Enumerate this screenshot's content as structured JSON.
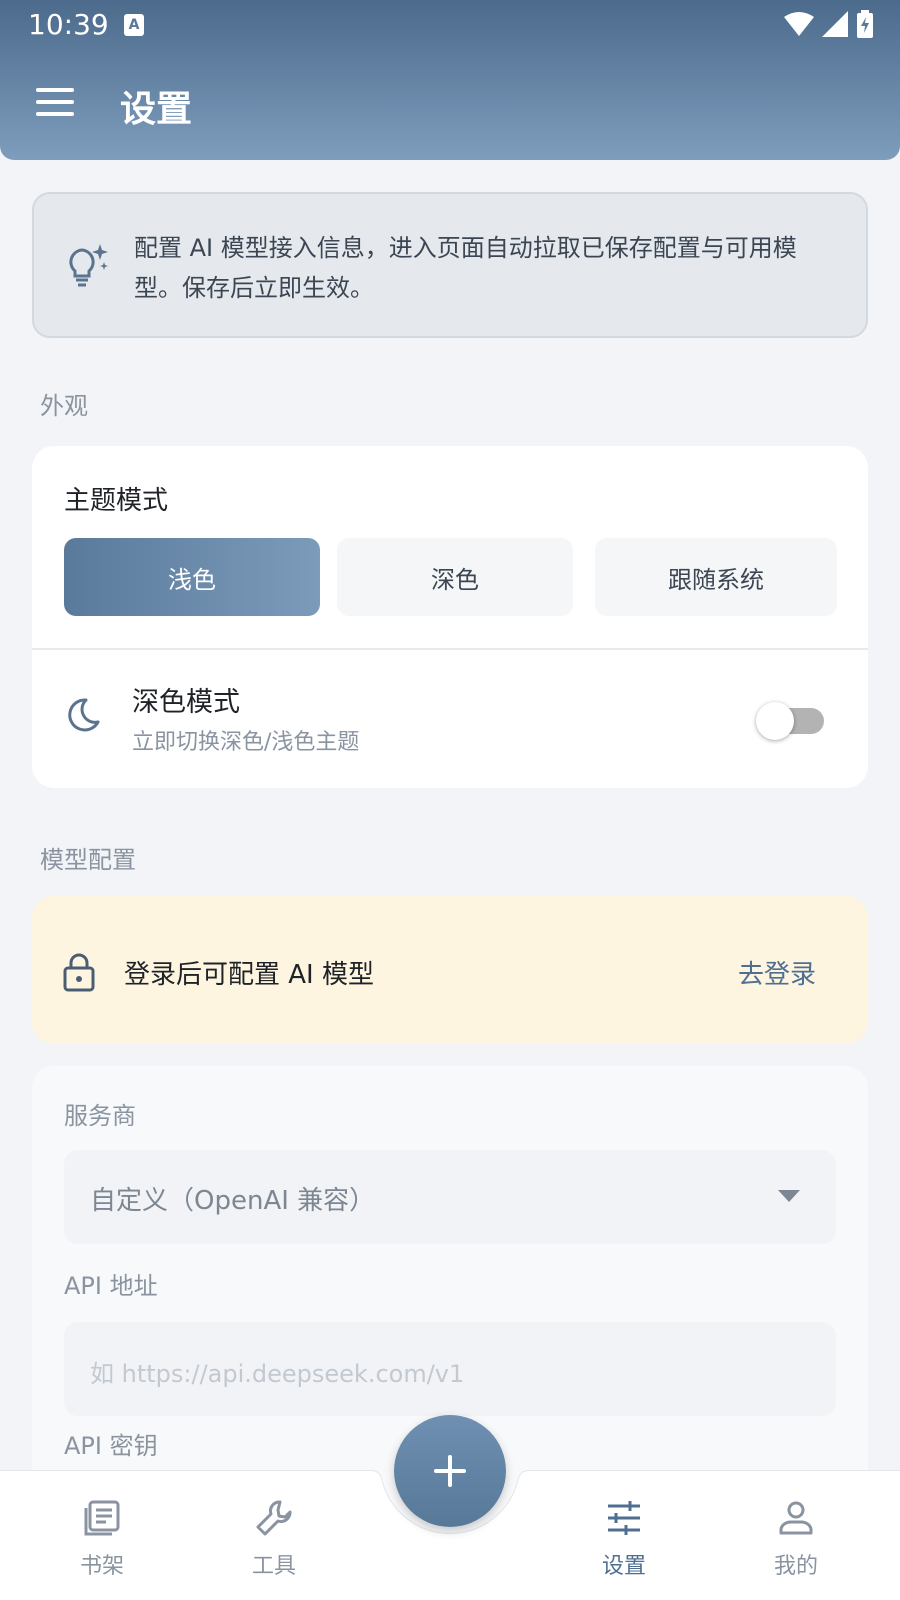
{
  "status_bar": {
    "time": "10:39",
    "a_icon": "A"
  },
  "app_bar": {
    "title": "设置",
    "menu_icon": "menu-icon"
  },
  "tip": {
    "icon": "lightbulb-sparkle-icon",
    "text": "配置 AI 模型接入信息，进入页面自动拉取已保存配置与可用模型。保存后立即生效。"
  },
  "appearance": {
    "section_label": "外观",
    "theme_title": "主题模式",
    "theme_options": [
      {
        "label": "浅色",
        "selected": true
      },
      {
        "label": "深色",
        "selected": false
      },
      {
        "label": "跟随系统",
        "selected": false
      }
    ],
    "dark_mode_title": "深色模式",
    "dark_mode_subtitle": "立即切换深色/浅色主题",
    "dark_mode_on": false
  },
  "model_config": {
    "section_label": "模型配置",
    "login_notice": "登录后可配置 AI 模型",
    "login_link": "去登录",
    "provider_label": "服务商",
    "provider_value": "自定义（OpenAI 兼容）",
    "api_url_label": "API 地址",
    "api_url_placeholder": "如 https://api.deepseek.com/v1",
    "api_key_label": "API 密钥"
  },
  "bottom_nav": {
    "items": [
      {
        "label": "书架",
        "icon": "bookshelf-icon",
        "active": false
      },
      {
        "label": "工具",
        "icon": "wrench-icon",
        "active": false
      },
      {
        "label": "设置",
        "icon": "sliders-icon",
        "active": true
      },
      {
        "label": "我的",
        "icon": "person-icon",
        "active": false
      }
    ],
    "fab_icon": "plus-icon"
  },
  "colors": {
    "accent": "#5a7a9c",
    "appbar_top": "#4c6b8c",
    "appbar_bottom": "#7e9dbd",
    "notice_bg": "#fdf5e0"
  }
}
